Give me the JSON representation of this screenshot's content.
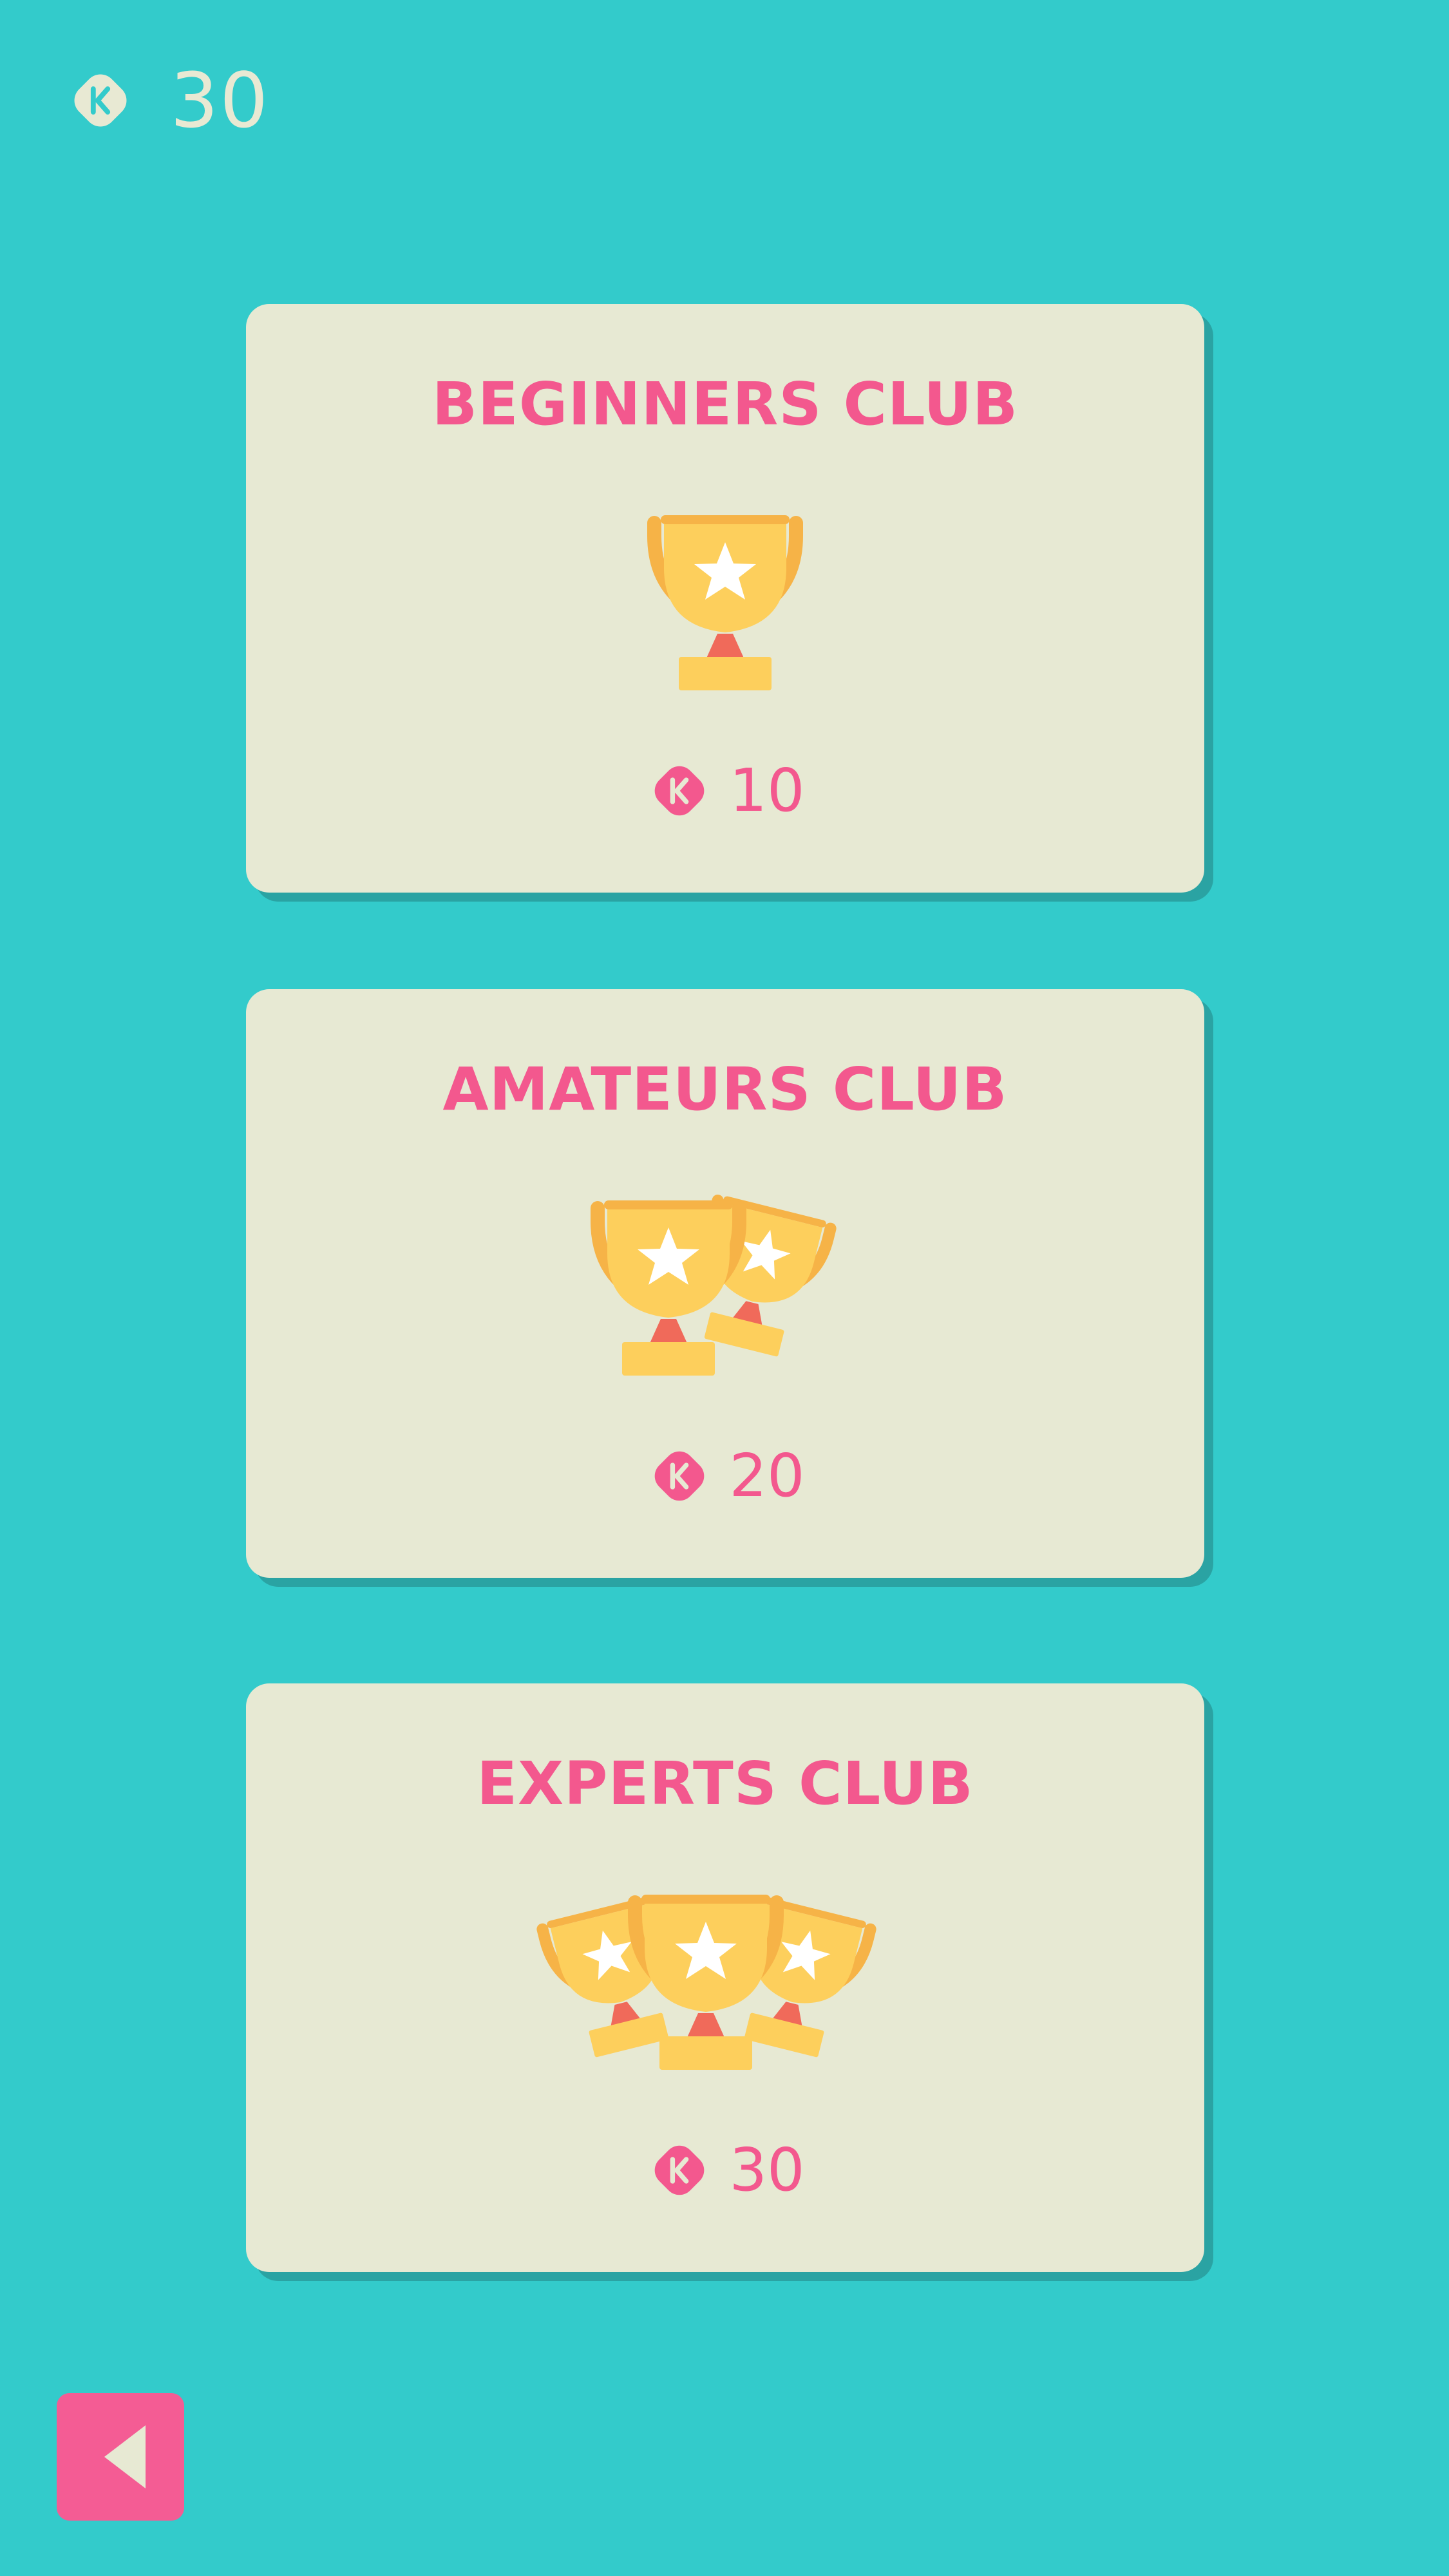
{
  "header": {
    "coins": "30",
    "coin_icon": "coin-icon",
    "coin_color": "#E8E9D3"
  },
  "clubs": [
    {
      "title": "BEGINNERS CLUB",
      "price": "10",
      "trophy_count": 1
    },
    {
      "title": "AMATEURS CLUB",
      "price": "20",
      "trophy_count": 2
    },
    {
      "title": "EXPERTS CLUB",
      "price": "30",
      "trophy_count": 3
    }
  ],
  "footer": {
    "back_icon": "back-arrow-icon"
  },
  "colors": {
    "background": "#33CBCB",
    "card": "#E7E9D3",
    "accent": "#F3588E",
    "trophy": "#FDCF5C",
    "trophy_dark": "#F6B347"
  }
}
